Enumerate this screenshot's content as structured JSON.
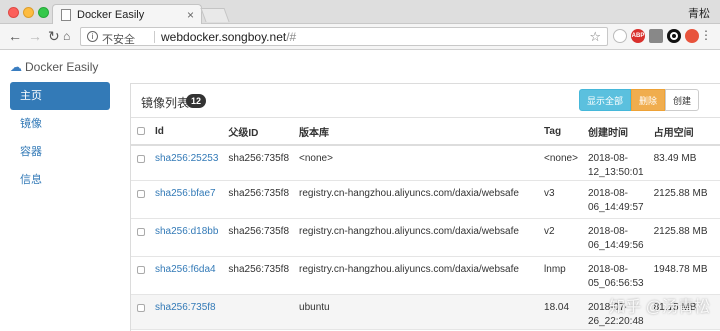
{
  "browser": {
    "tab_title": "Docker Easily",
    "profile_name": "青松",
    "omnibox": {
      "security_label": "不安全",
      "url_host": "webdocker.songboy.net",
      "url_rest": "/#"
    },
    "extensions": [
      {
        "name": "circle-ext",
        "color": "#cccccc",
        "text": ""
      },
      {
        "name": "abp-ext",
        "color": "#d9302c",
        "text": "ABP"
      },
      {
        "name": "grey-ext",
        "color": "#888888",
        "text": ""
      },
      {
        "name": "ring-ext",
        "color": "#111111",
        "text": ""
      },
      {
        "name": "red-ext",
        "color": "#e8533c",
        "text": ""
      }
    ]
  },
  "app": {
    "brand": "Docker Easily",
    "sidebar": {
      "items": [
        {
          "label": "主页",
          "active": true
        },
        {
          "label": "镜像",
          "active": false
        },
        {
          "label": "容器",
          "active": false
        },
        {
          "label": "信息",
          "active": false
        }
      ]
    },
    "panel": {
      "title": "镜像列表",
      "count": "12",
      "buttons": {
        "show_all": "显示全部",
        "delete": "删除",
        "create": "创建"
      },
      "columns": [
        "Id",
        "父级ID",
        "版本库",
        "Tag",
        "创建时间",
        "占用空间"
      ],
      "rows": [
        {
          "id": "sha256:25253",
          "parent": "sha256:735f8",
          "repo": "<none>",
          "tag": "<none>",
          "created": "2018-08-12_13:50:01",
          "size": "83.49 MB"
        },
        {
          "id": "sha256:bfae7",
          "parent": "sha256:735f8",
          "repo": "registry.cn-hangzhou.aliyuncs.com/daxia/websafe",
          "tag": "v3",
          "created": "2018-08-06_14:49:57",
          "size": "2125.88 MB"
        },
        {
          "id": "sha256:d18bb",
          "parent": "sha256:735f8",
          "repo": "registry.cn-hangzhou.aliyuncs.com/daxia/websafe",
          "tag": "v2",
          "created": "2018-08-06_14:49:56",
          "size": "2125.88 MB"
        },
        {
          "id": "sha256:f6da4",
          "parent": "sha256:735f8",
          "repo": "registry.cn-hangzhou.aliyuncs.com/daxia/websafe",
          "tag": "lnmp",
          "created": "2018-08-05_06:56:53",
          "size": "1948.78 MB"
        },
        {
          "id": "sha256:735f8",
          "parent": "",
          "repo": "ubuntu",
          "tag": "18.04",
          "created": "2018-07-26_22:20:48",
          "size": "81.15 MB"
        }
      ]
    },
    "watermark": "知乎 @汤青松"
  },
  "colors": {
    "primary": "#337ab7",
    "info": "#5bc0de",
    "warning": "#f0ad4e"
  }
}
